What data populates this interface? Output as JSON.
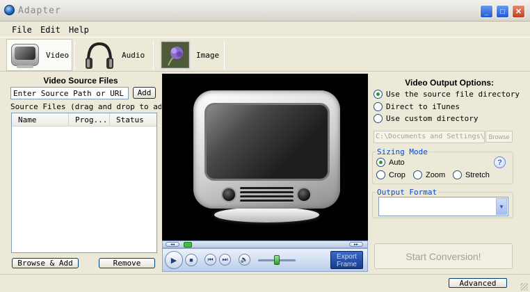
{
  "window": {
    "title": "Adapter"
  },
  "menu": [
    "File",
    "Edit",
    "Help"
  ],
  "modes": [
    {
      "label": "Video",
      "icon": "tv-icon",
      "active": true
    },
    {
      "label": "Audio",
      "icon": "headphones-icon",
      "active": false
    },
    {
      "label": "Image",
      "icon": "flower-photo-icon",
      "active": false
    }
  ],
  "source": {
    "title": "Video Source Files",
    "input_value": "Enter Source Path or URL",
    "add_label": "Add",
    "hint": "Source Files (drag and drop to add more",
    "columns": [
      "Name",
      "Prog...",
      "Status"
    ],
    "browse_label": "Browse & Add",
    "remove_label": "Remove"
  },
  "player": {
    "export_label_1": "Export",
    "export_label_2": "Frame"
  },
  "output": {
    "title": "Video Output Options:",
    "destinations": [
      {
        "label": "Use the source file directory",
        "selected": true
      },
      {
        "label": "Direct to iTunes",
        "selected": false
      },
      {
        "label": "Use custom directory",
        "selected": false
      }
    ],
    "custom_dir": "C:\\Documents and Settings\\",
    "browse_label": "Browse",
    "sizing_legend": "Sizing Mode",
    "sizing": [
      {
        "label": "Auto",
        "selected": true
      },
      {
        "label": "Crop",
        "selected": false
      },
      {
        "label": "Zoom",
        "selected": false
      },
      {
        "label": "Stretch",
        "selected": false
      }
    ],
    "format_legend": "Output Format",
    "format_value": "",
    "start_label": "Start Conversion!"
  },
  "footer": {
    "advanced_label": "Advanced"
  }
}
